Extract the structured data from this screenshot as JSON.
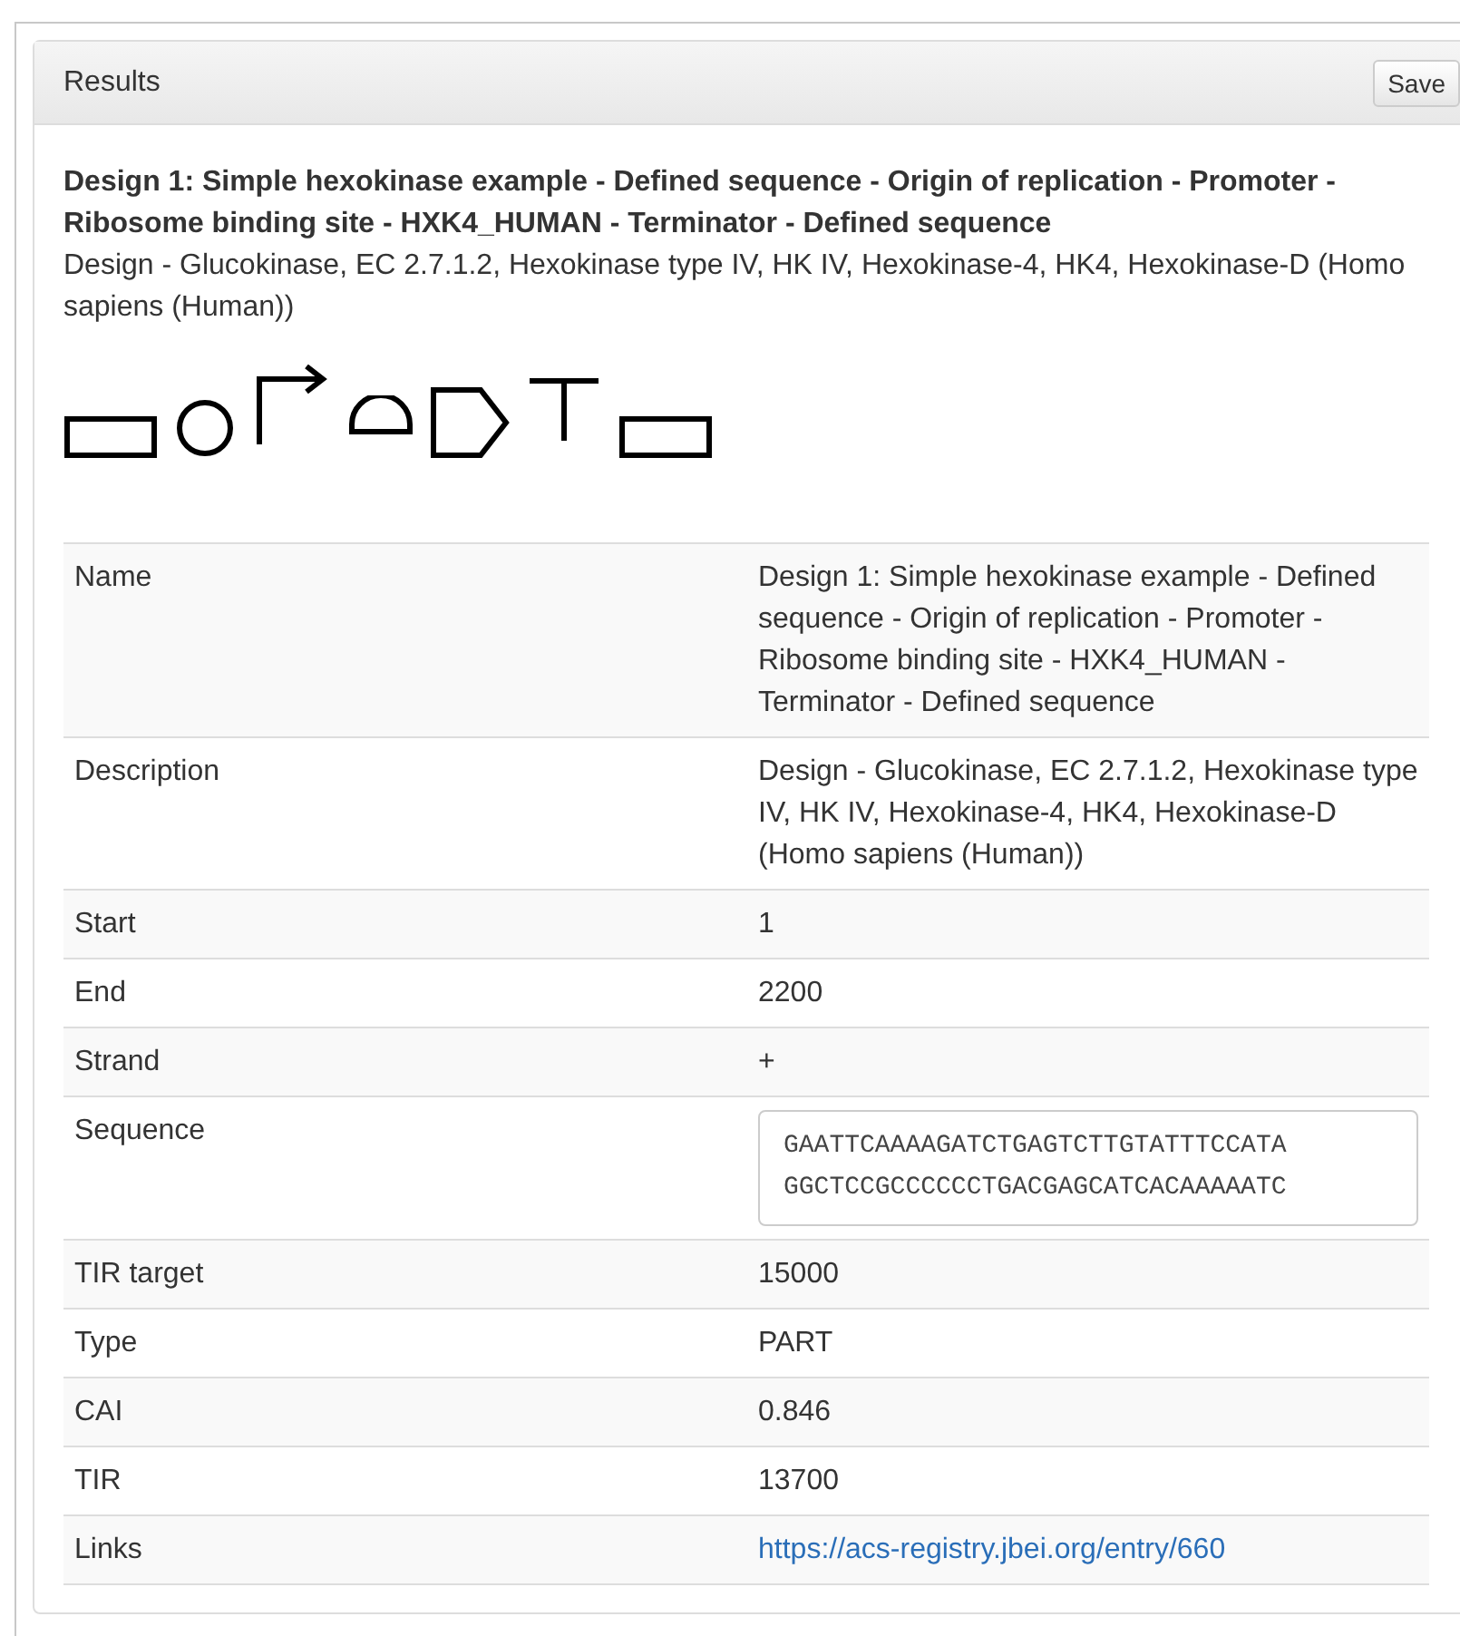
{
  "panel": {
    "title": "Results",
    "save_button": "Save"
  },
  "design": {
    "title": "Design 1: Simple hexokinase example - Defined sequence - Origin of replication - Promoter - Ribosome binding site - HXK4_HUMAN - Terminator - Defined sequence",
    "description": "Design - Glucokinase, EC 2.7.1.2, Hexokinase type IV, HK IV, Hexokinase-4, HK4, Hexokinase-D (Homo sapiens (Human))",
    "glyphs": [
      {
        "kind": "sequence"
      },
      {
        "kind": "origin"
      },
      {
        "kind": "promoter"
      },
      {
        "kind": "rbs"
      },
      {
        "kind": "cds"
      },
      {
        "kind": "terminator"
      },
      {
        "kind": "sequence"
      }
    ]
  },
  "table": {
    "rows": [
      {
        "kind": "text",
        "label": "Name",
        "value": "Design 1: Simple hexokinase example - Defined sequence - Origin of replication - Promoter - Ribosome binding site - HXK4_HUMAN - Terminator - Defined sequence"
      },
      {
        "kind": "text",
        "label": "Description",
        "value": "Design - Glucokinase, EC 2.7.1.2, Hexokinase type IV, HK IV, Hexokinase-4, HK4, Hexokinase-D (Homo sapiens (Human))"
      },
      {
        "kind": "text",
        "label": "Start",
        "value": "1"
      },
      {
        "kind": "text",
        "label": "End",
        "value": "2200"
      },
      {
        "kind": "text",
        "label": "Strand",
        "value": "+"
      },
      {
        "kind": "sequence",
        "label": "Sequence",
        "lines": [
          "GAATTCAAAAGATCTGAGTCTTGTATTTCCATA",
          "GGCTCCGCCCCCCTGACGAGCATCACAAAAATC"
        ]
      },
      {
        "kind": "text",
        "label": "TIR target",
        "value": "15000"
      },
      {
        "kind": "text",
        "label": "Type",
        "value": "PART"
      },
      {
        "kind": "text",
        "label": "CAI",
        "value": "0.846"
      },
      {
        "kind": "text",
        "label": "TIR",
        "value": "13700"
      },
      {
        "kind": "link",
        "label": "Links",
        "value": "https://acs-registry.jbei.org/entry/660"
      }
    ]
  }
}
